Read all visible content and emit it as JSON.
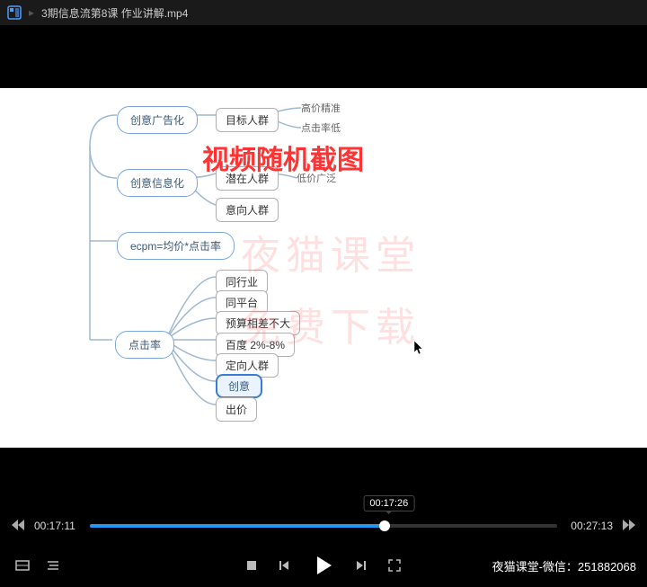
{
  "title_bar": {
    "title": "3期信息流第8课 作业讲解.mp4",
    "sep": "▸"
  },
  "slide": {
    "overlay_title": "视频随机截图",
    "watermark1": "夜猫课堂",
    "watermark2": "免费下载",
    "nodes": {
      "n1": "创意广告化",
      "n1a": "目标人群",
      "n1a1": "高价精准",
      "n1a2": "点击率低",
      "n2": "创意信息化",
      "n2a": "潜在人群",
      "n2a1": "低价广泛",
      "n2b": "意向人群",
      "n3": "ecpm=均价*点击率",
      "n4": "点击率",
      "n4a": "同行业",
      "n4b": "同平台",
      "n4c": "预算相差不大",
      "n4d": "百度 2%-8%",
      "n4e": "定向人群",
      "n4f": "创意",
      "n4g": "出价"
    }
  },
  "player": {
    "current": "00:17:11",
    "total": "00:27:13",
    "seek_tip": "00:17:26",
    "progress_pct": 63,
    "tip_pct": 64
  },
  "credit": "夜猫课堂-微信：251882068"
}
